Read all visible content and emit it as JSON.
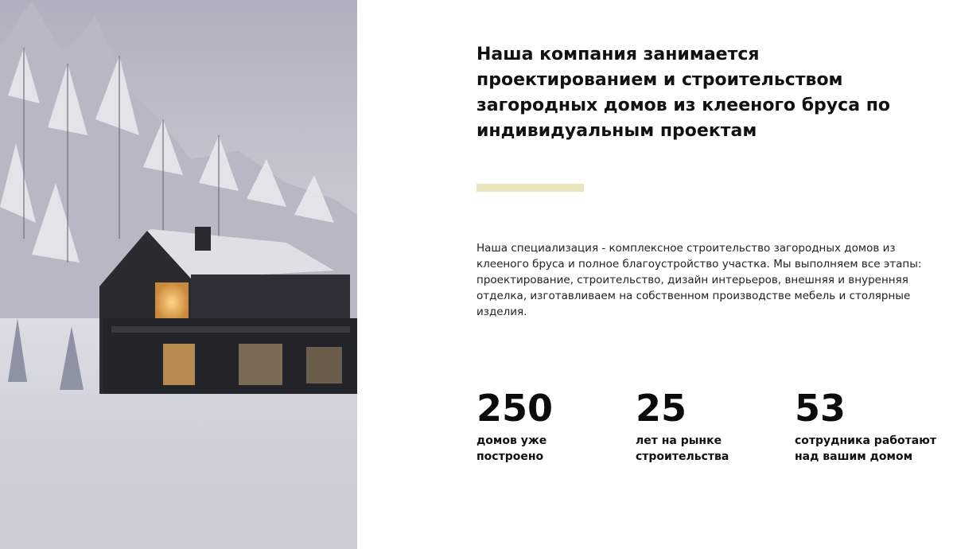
{
  "hero_image": {
    "subject": "Modern dark house in snowy forest at dusk"
  },
  "headline": "Наша компания занимается проектированием и строительством загородных домов из клееного бруса по индивидуальным проектам",
  "accent_color": "#ebe5be",
  "description": "Наша специализация - комплексное строительство загородных домов из клееного бруса и полное благоустройство участка. Мы выполняем все этапы: проектирование, строительство, дизайн интерьеров, внешняя и внуренняя отделка, изготавливаем на собственном производстве мебель и столярные изделия.",
  "stats": [
    {
      "number": "250",
      "label": "домов уже\nпостроено"
    },
    {
      "number": "25",
      "label": "лет на рынке\nстроительства"
    },
    {
      "number": "53",
      "label": "сотрудника работают\nнад вашим домом"
    }
  ]
}
